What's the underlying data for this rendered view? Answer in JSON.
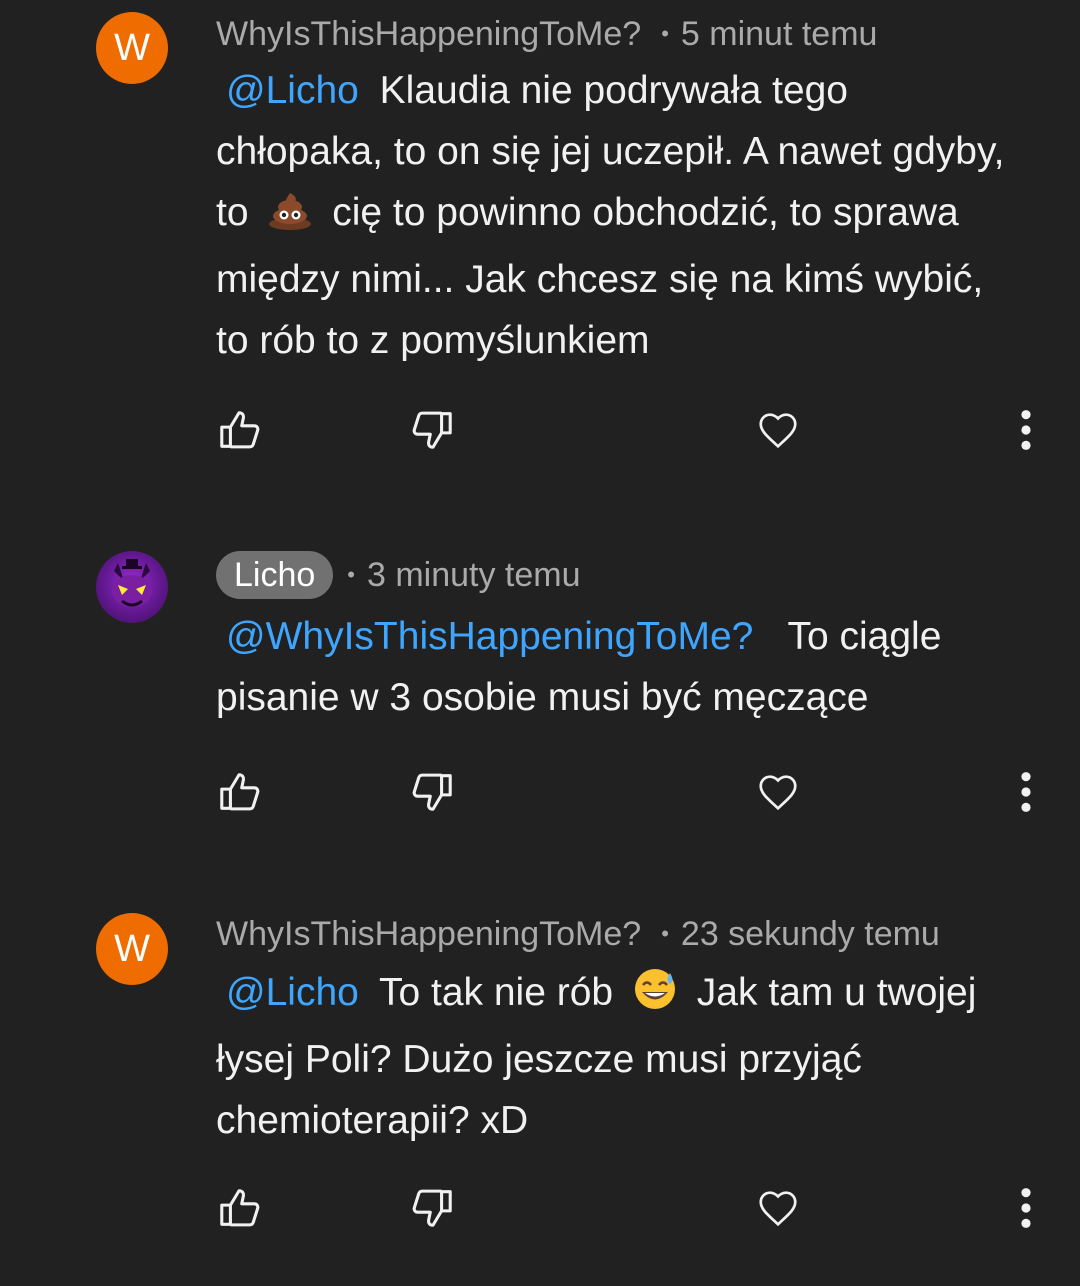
{
  "comments": [
    {
      "avatar_letter": "W",
      "avatar_color": "#ef6c00",
      "author": "WhyIsThisHappeningToMe?",
      "time": "5 minut temu",
      "mention": "@Licho",
      "text_before_emoji": "Klaudia nie podrywała tego chłopaka, to on się jej uczepił. A nawet gdyby, to",
      "emoji": "poop-emoji",
      "text_after_emoji": "cię to powinno obchodzić, to sprawa między nimi... Jak chcesz się na kimś wybić, to rób to z pomyślunkiem"
    },
    {
      "avatar_icon": "demon-character-avatar",
      "author": "Licho",
      "author_highlighted": true,
      "time": "3 minuty temu",
      "mention": "@WhyIsThisHappeningToMe?",
      "text": "To ciągle pisanie w 3 osobie musi być męczące"
    },
    {
      "avatar_letter": "W",
      "avatar_color": "#ef6c00",
      "author": "WhyIsThisHappeningToMe?",
      "time": "23 sekundy temu",
      "mention": "@Licho",
      "text_before_emoji": "To tak nie rób",
      "emoji": "grinning-sweat-emoji",
      "text_after_emoji": "Jak tam u twojej łysej Poli? Dużo jeszcze musi przyjąć chemioterapii? xD"
    }
  ],
  "colors": {
    "background": "#212121",
    "mention": "#3ea6ff",
    "meta": "#aaaaaa",
    "text": "#f1f1f1",
    "author_chip": "#717171"
  },
  "icons": [
    "like-icon",
    "dislike-icon",
    "heart-icon",
    "more-vert-icon"
  ]
}
